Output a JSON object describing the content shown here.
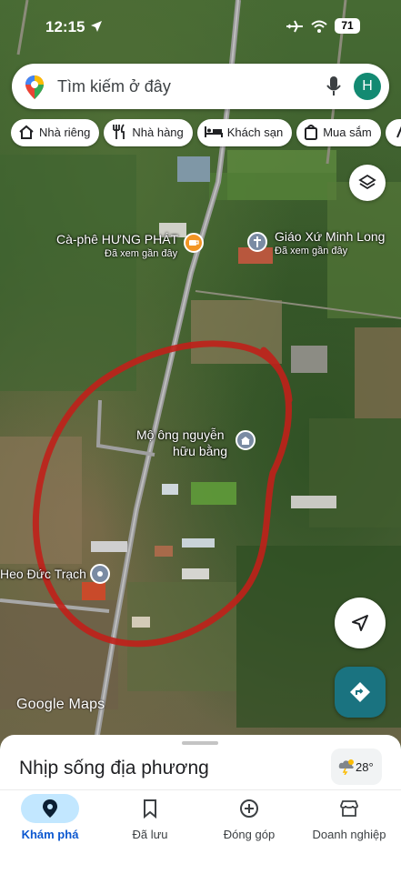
{
  "status_bar": {
    "time": "12:15",
    "battery": "71"
  },
  "search": {
    "placeholder": "Tìm kiếm ở đây",
    "avatar_letter": "H"
  },
  "chips": [
    {
      "label": "Nhà riêng",
      "icon": "home-icon"
    },
    {
      "label": "Nhà hàng",
      "icon": "restaurant-icon"
    },
    {
      "label": "Khách sạn",
      "icon": "hotel-icon"
    },
    {
      "label": "Mua sắm",
      "icon": "shopping-icon"
    }
  ],
  "map": {
    "pois": [
      {
        "name": "Cà-phê HƯNG PHÁT",
        "sub": "Đã xem gần đây",
        "icon": "coffee-icon"
      },
      {
        "name": "Giáo Xứ Minh Long",
        "sub": "Đã xem gần đây",
        "icon": "church-icon"
      },
      {
        "name": "Mộ ông nguyễn hữu bằng",
        "line1": "Mộ ông nguyễn",
        "line2": "hữu bằng",
        "icon": "monument-icon"
      },
      {
        "name": "Heo Đức Trạch",
        "icon": "place-icon"
      }
    ],
    "watermark": "Google Maps",
    "colors": {
      "annotation": "#c0201a",
      "fab_directions": "#1a7380"
    }
  },
  "sheet": {
    "title": "Nhịp sống địa phương",
    "weather": "28°"
  },
  "nav": [
    {
      "label": "Khám phá",
      "icon": "explore-pin-icon",
      "active": true
    },
    {
      "label": "Đã lưu",
      "icon": "bookmark-icon",
      "active": false
    },
    {
      "label": "Đóng góp",
      "icon": "add-circle-icon",
      "active": false
    },
    {
      "label": "Doanh nghiệp",
      "icon": "storefront-icon",
      "active": false
    }
  ]
}
